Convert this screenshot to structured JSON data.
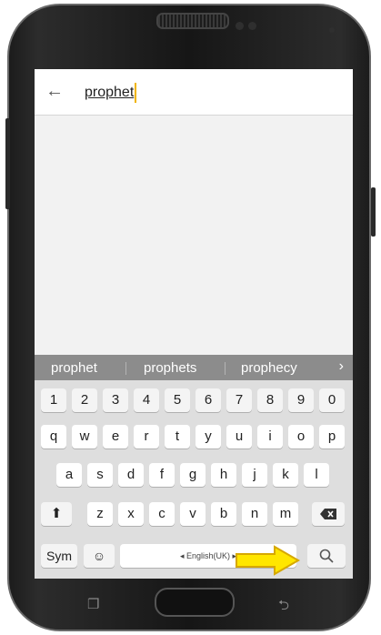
{
  "search": {
    "query": "prophet"
  },
  "suggestions": [
    "prophet",
    "prophets",
    "prophecy"
  ],
  "keyboard": {
    "row_numbers": [
      "1",
      "2",
      "3",
      "4",
      "5",
      "6",
      "7",
      "8",
      "9",
      "0"
    ],
    "row_top": [
      "q",
      "w",
      "e",
      "r",
      "t",
      "y",
      "u",
      "i",
      "o",
      "p"
    ],
    "row_middle": [
      "a",
      "s",
      "d",
      "f",
      "g",
      "h",
      "j",
      "k",
      "l"
    ],
    "row_bottom": [
      "z",
      "x",
      "c",
      "v",
      "b",
      "n",
      "m"
    ],
    "sym_label": "Sym",
    "language_label": "English(UK)"
  }
}
